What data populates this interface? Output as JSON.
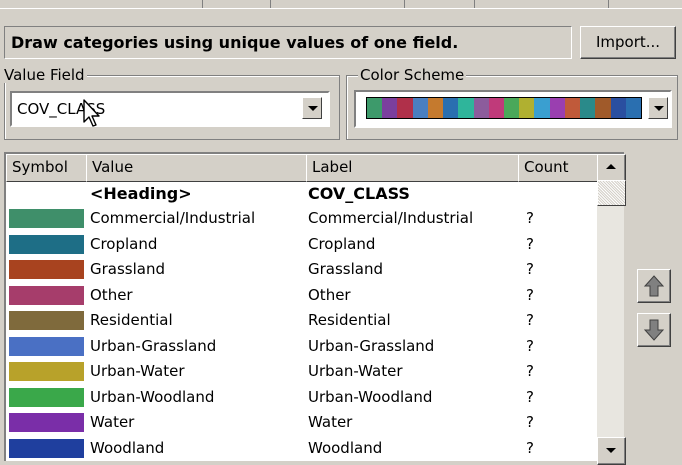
{
  "panel": {
    "title": "Draw categories using unique values of one field.",
    "import_label": "Import..."
  },
  "value_field": {
    "label": "Value Field",
    "value": "COV_CLASS"
  },
  "color_scheme": {
    "label": "Color Scheme",
    "colors": [
      "#3d9a6b",
      "#7b3f9e",
      "#b0304a",
      "#4a7fc0",
      "#c57a2e",
      "#2a6fb0",
      "#2fb59b",
      "#8c5c9c",
      "#c03a7a",
      "#4aa85a",
      "#b0b030",
      "#3a9fd0",
      "#9a3fb0",
      "#c05a3a",
      "#2a8a8a",
      "#a05a2a",
      "#2a4fa0",
      "#2a6fb0"
    ]
  },
  "table": {
    "columns": [
      "Symbol",
      "Value",
      "Label",
      "Count"
    ],
    "heading_row": {
      "value": "<Heading>",
      "label": "COV_CLASS"
    },
    "rows": [
      {
        "value": "Commercial/Industrial",
        "label": "Commercial/Industrial",
        "count": "?",
        "color": "#3f8f6a"
      },
      {
        "value": "Cropland",
        "label": "Cropland",
        "count": "?",
        "color": "#1e6e86"
      },
      {
        "value": "Grassland",
        "label": "Grassland",
        "count": "?",
        "color": "#a8431f"
      },
      {
        "value": "Other",
        "label": "Other",
        "count": "?",
        "color": "#a63d6b"
      },
      {
        "value": "Residential",
        "label": "Residential",
        "count": "?",
        "color": "#7f6a3c"
      },
      {
        "value": "Urban-Grassland",
        "label": "Urban-Grassland",
        "count": "?",
        "color": "#4a70c4"
      },
      {
        "value": "Urban-Water",
        "label": "Urban-Water",
        "count": "?",
        "color": "#b8a22a"
      },
      {
        "value": "Urban-Woodland",
        "label": "Urban-Woodland",
        "count": "?",
        "color": "#3aa84a"
      },
      {
        "value": "Water",
        "label": "Water",
        "count": "?",
        "color": "#7a2ea8"
      },
      {
        "value": "Woodland",
        "label": "Woodland",
        "count": "?",
        "color": "#1f3f9e"
      }
    ]
  }
}
